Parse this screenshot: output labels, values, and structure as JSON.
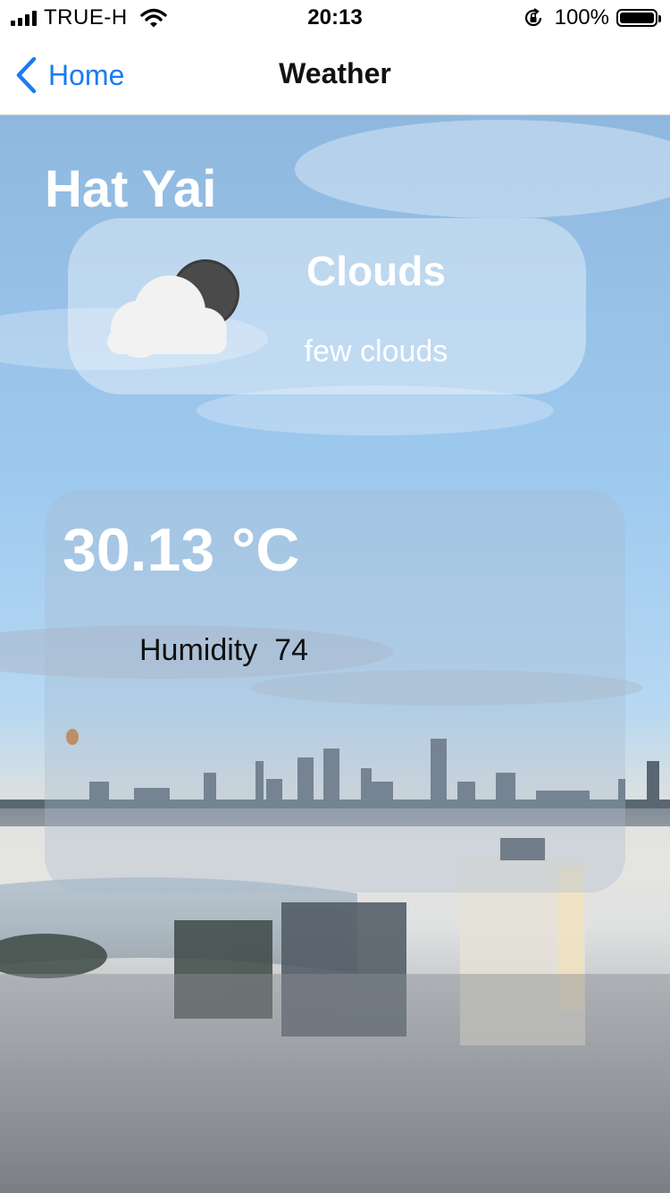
{
  "status_bar": {
    "carrier": "TRUE-H",
    "time": "20:13",
    "battery": "100%",
    "icons": [
      "signal-icon",
      "wifi-icon",
      "orientation-lock-icon",
      "battery-icon"
    ]
  },
  "nav": {
    "back_label": "Home",
    "title": "Weather",
    "accent_color": "#1a7cf2"
  },
  "weather": {
    "city": "Hat Yai",
    "condition": "Clouds",
    "description": "few clouds",
    "icon": "cloud-night-icon",
    "temperature": "30.13 °C",
    "humidity_label": "Humidity",
    "humidity_value": "74"
  }
}
